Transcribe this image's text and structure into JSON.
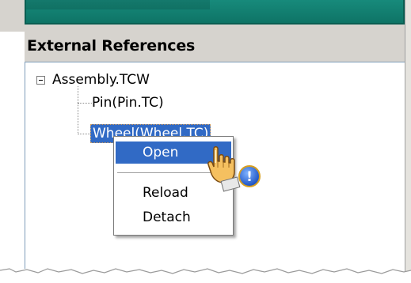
{
  "panel": {
    "title": "External References"
  },
  "tree": {
    "root": "Assembly.TCW",
    "children": [
      "Pin(Pin.TC)",
      "Wheel(Wheel.TC)"
    ],
    "selected_index": 1
  },
  "context_menu": {
    "items": [
      "Open",
      "Reload",
      "Detach"
    ],
    "highlighted": "Open"
  },
  "icons": {
    "expander": "minus-box-icon",
    "cursor": "hand-pointer-icon",
    "badge": "info-exclamation-icon"
  },
  "colors": {
    "accent_teal": "#178a7b",
    "selection_blue": "#316ac5",
    "panel_gray": "#d6d3ce"
  }
}
